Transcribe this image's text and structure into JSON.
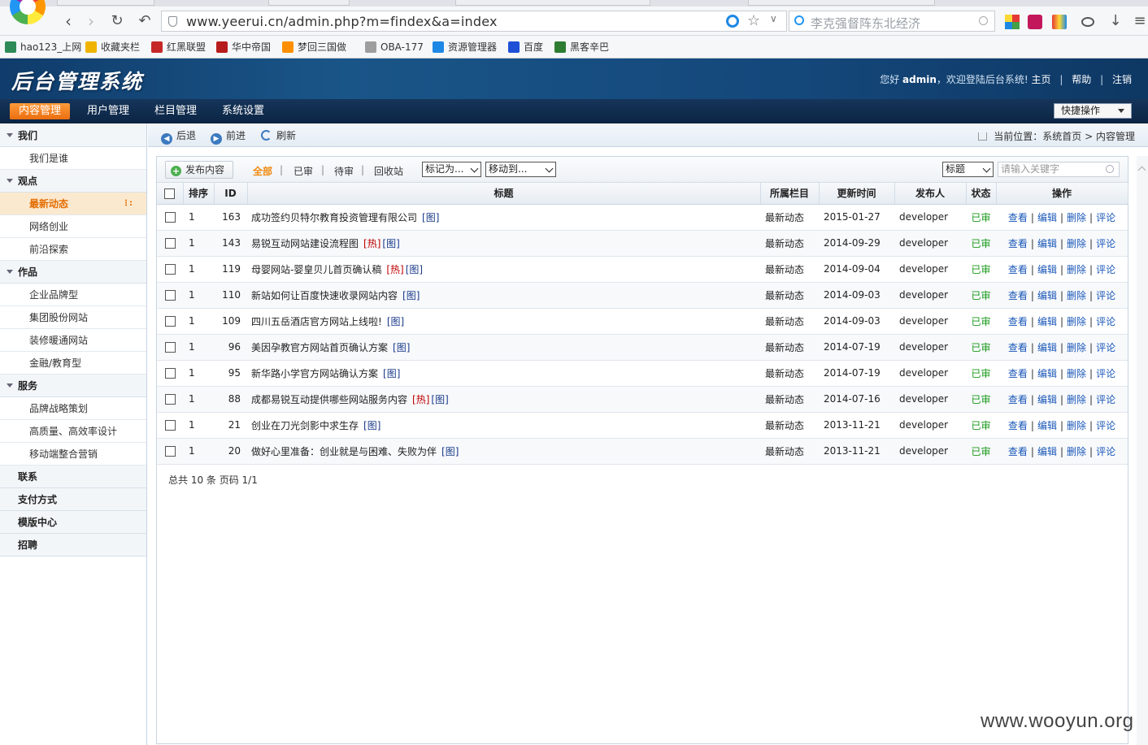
{
  "browser": {
    "url": "www.yeerui.cn/admin.php?m=findex&a=index",
    "search_placeholder": "李克强督阵东北经济",
    "bookmarks": [
      {
        "label": "hao123_上网",
        "color": "#2e8b57"
      },
      {
        "label": "收藏夹栏",
        "color": "#f0b400"
      },
      {
        "label": "红黑联盟",
        "color": "#c62828"
      },
      {
        "label": "华中帝国",
        "color": "#b71c1c"
      },
      {
        "label": "梦回三国做",
        "color": "#ff8f00"
      },
      {
        "label": "OBA-177",
        "color": "#9e9e9e"
      },
      {
        "label": "资源管理器",
        "color": "#1e88e5"
      },
      {
        "label": "百度",
        "color": "#1e4fd6"
      },
      {
        "label": "黑客辛巴",
        "color": "#2e7d32"
      }
    ]
  },
  "header": {
    "logo": "后台管理系统",
    "greeting": "您好",
    "user": "admin",
    "welcome": "，欢迎登陆后台系统!",
    "links": [
      "主页",
      "帮助",
      "注销"
    ]
  },
  "nav": {
    "tabs": [
      "内容管理",
      "用户管理",
      "栏目管理",
      "系统设置"
    ],
    "active": "内容管理",
    "quick": "快捷操作"
  },
  "sidebar": {
    "groups": [
      {
        "label": "我们",
        "items": [
          "我们是谁"
        ]
      },
      {
        "label": "观点",
        "items": [
          "最新动态",
          "网络创业",
          "前沿探索"
        ]
      },
      {
        "label": "作品",
        "items": [
          "企业品牌型",
          "集团股份网站",
          "装修暖通网站",
          "金融/教育型"
        ]
      },
      {
        "label": "服务",
        "items": [
          "品牌战略策划",
          "高质量、高效率设计",
          "移动端整合营销"
        ]
      },
      {
        "label": "联系",
        "items": []
      },
      {
        "label": "支付方式",
        "items": []
      },
      {
        "label": "模版中心",
        "items": []
      },
      {
        "label": "招聘",
        "items": []
      }
    ],
    "active_item": "最新动态"
  },
  "toolbar": {
    "back": "后退",
    "forward": "前进",
    "refresh": "刷新",
    "crumb_prefix": "当前位置：",
    "crumb_home": "系统首页",
    "crumb_current": "内容管理"
  },
  "filters": {
    "publish": "发布内容",
    "tabs": [
      "全部",
      "已审",
      "待审",
      "回收站"
    ],
    "mark_as": "标记为...",
    "move_to": "移动到...",
    "field": "标题",
    "keyword_placeholder": "请输入关键字"
  },
  "table": {
    "headers": [
      "排序",
      "ID",
      "标题",
      "所属栏目",
      "更新时间",
      "发布人",
      "状态",
      "操作"
    ],
    "actions": [
      "查看",
      "编辑",
      "删除",
      "评论"
    ],
    "rows": [
      {
        "sort": "1",
        "id": "163",
        "title": "成功签约贝特尔教育投资管理有限公司",
        "hot": false,
        "category": "最新动态",
        "date": "2015-01-27",
        "author": "developer",
        "status": "已审"
      },
      {
        "sort": "1",
        "id": "143",
        "title": "易锐互动网站建设流程图",
        "hot": true,
        "category": "最新动态",
        "date": "2014-09-29",
        "author": "developer",
        "status": "已审"
      },
      {
        "sort": "1",
        "id": "119",
        "title": "母婴网站-婴皇贝儿首页确认稿",
        "hot": true,
        "category": "最新动态",
        "date": "2014-09-04",
        "author": "developer",
        "status": "已审"
      },
      {
        "sort": "1",
        "id": "110",
        "title": "新站如何让百度快速收录网站内容",
        "hot": false,
        "category": "最新动态",
        "date": "2014-09-03",
        "author": "developer",
        "status": "已审"
      },
      {
        "sort": "1",
        "id": "109",
        "title": "四川五岳酒店官方网站上线啦!",
        "hot": false,
        "category": "最新动态",
        "date": "2014-09-03",
        "author": "developer",
        "status": "已审"
      },
      {
        "sort": "1",
        "id": "96",
        "title": "美因孕教官方网站首页确认方案",
        "hot": false,
        "category": "最新动态",
        "date": "2014-07-19",
        "author": "developer",
        "status": "已审"
      },
      {
        "sort": "1",
        "id": "95",
        "title": "新华路小学官方网站确认方案",
        "hot": false,
        "category": "最新动态",
        "date": "2014-07-19",
        "author": "developer",
        "status": "已审"
      },
      {
        "sort": "1",
        "id": "88",
        "title": "成都易锐互动提供哪些网站服务内容",
        "hot": true,
        "category": "最新动态",
        "date": "2014-07-16",
        "author": "developer",
        "status": "已审"
      },
      {
        "sort": "1",
        "id": "21",
        "title": "创业在刀光剑影中求生存",
        "hot": false,
        "category": "最新动态",
        "date": "2013-11-21",
        "author": "developer",
        "status": "已审"
      },
      {
        "sort": "1",
        "id": "20",
        "title": "做好心里准备：创业就是与困难、失败为伴",
        "hot": false,
        "category": "最新动态",
        "date": "2013-11-21",
        "author": "developer",
        "status": "已审"
      }
    ],
    "tag_hot": "[热]",
    "tag_img": "[图]"
  },
  "summary": "总共  10 条  页码  1/1",
  "watermark": "www.wooyun.org"
}
